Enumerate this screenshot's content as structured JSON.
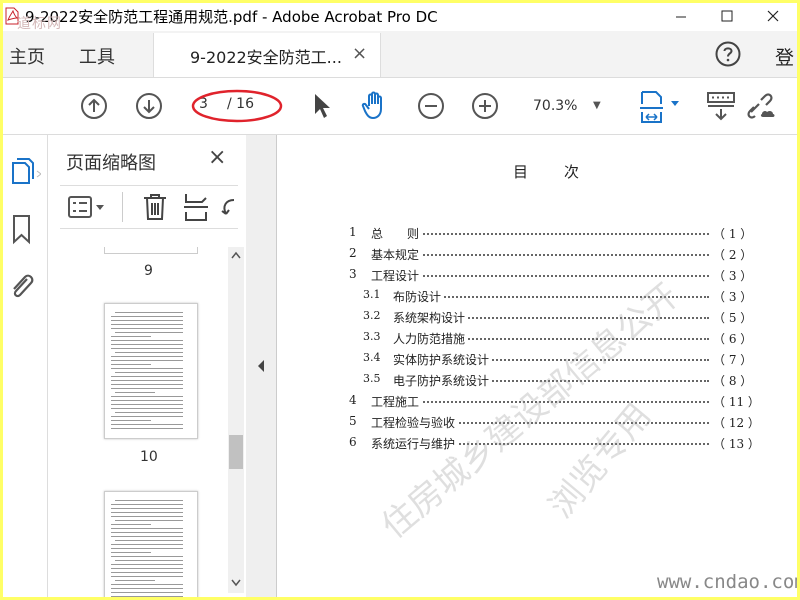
{
  "window": {
    "title": "9-2022安全防范工程通用规范.pdf - Adobe Acrobat Pro DC",
    "watermark_logo": "道标网"
  },
  "menubar": {
    "home": "主页",
    "tools": "工具",
    "tab_label": "9-2022安全防范工...",
    "tab_close": "×",
    "login": "登"
  },
  "toolbar": {
    "page_current": "3",
    "page_total": "/ 16",
    "zoom": "70.3%",
    "highlight_color": "#e0232c"
  },
  "panel": {
    "title": "页面缩略图",
    "close": "×",
    "thumbs": [
      {
        "label": "9"
      },
      {
        "label": "10"
      }
    ]
  },
  "document": {
    "toc_heading": "目次",
    "toc": [
      {
        "num": "1",
        "title": "总　　则",
        "page": "（ 1 ）",
        "sub": false
      },
      {
        "num": "2",
        "title": "基本规定",
        "page": "（ 2 ）",
        "sub": false
      },
      {
        "num": "3",
        "title": "工程设计",
        "page": "（ 3 ）",
        "sub": false
      },
      {
        "num": "3.1",
        "title": "布防设计",
        "page": "（ 3 ）",
        "sub": true
      },
      {
        "num": "3.2",
        "title": "系统架构设计",
        "page": "（ 5 ）",
        "sub": true
      },
      {
        "num": "3.3",
        "title": "人力防范措施",
        "page": "（ 6 ）",
        "sub": true
      },
      {
        "num": "3.4",
        "title": "实体防护系统设计",
        "page": "（ 7 ）",
        "sub": true
      },
      {
        "num": "3.5",
        "title": "电子防护系统设计",
        "page": "（ 8 ）",
        "sub": true
      },
      {
        "num": "4",
        "title": "工程施工",
        "page": "（ 11 ）",
        "sub": false
      },
      {
        "num": "5",
        "title": "工程检验与验收",
        "page": "（ 12 ）",
        "sub": false
      },
      {
        "num": "6",
        "title": "系统运行与维护",
        "page": "（ 13 ）",
        "sub": false
      }
    ],
    "watermark_1": "住房城乡建设部信息公开",
    "watermark_2": "浏览专用",
    "site_watermark": "www.cndao.com"
  }
}
